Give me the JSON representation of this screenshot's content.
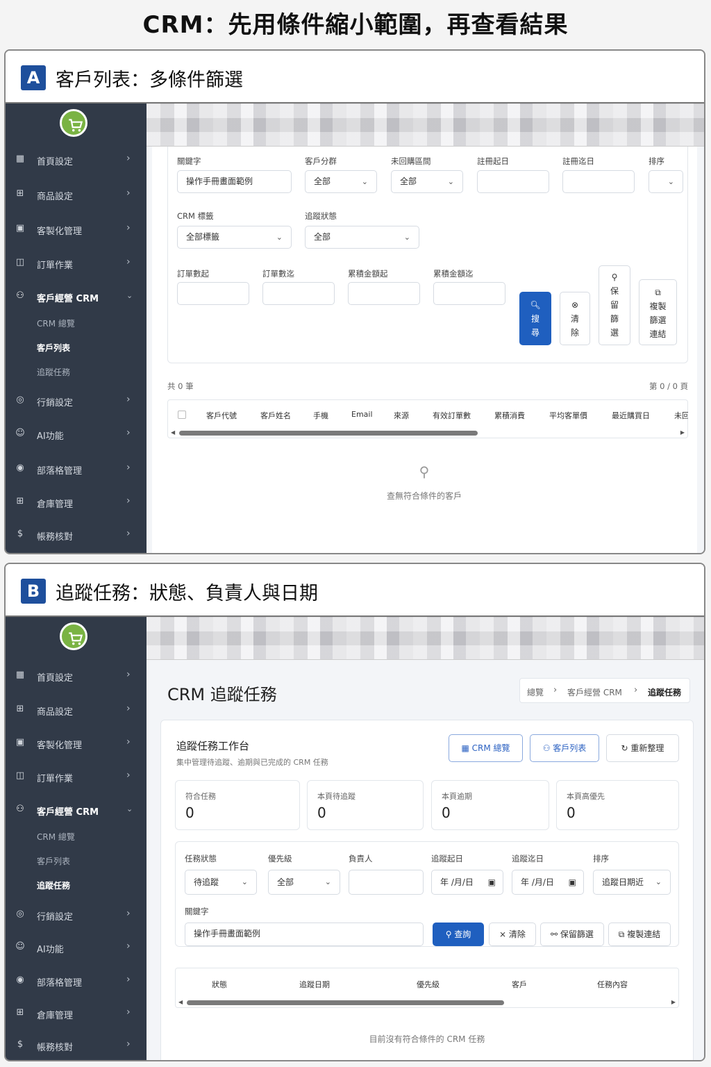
{
  "main_title": "CRM：先用條件縮小範圍，再查看結果",
  "panel_a": {
    "badge": "A",
    "title": "客戶列表：多條件篩選",
    "sidebar": {
      "items": [
        {
          "icon": "store-icon",
          "label": "首頁設定"
        },
        {
          "icon": "gift-icon",
          "label": "商品設定"
        },
        {
          "icon": "layout-icon",
          "label": "客製化管理"
        },
        {
          "icon": "clipboard-icon",
          "label": "訂單作業"
        },
        {
          "icon": "users-icon",
          "label": "客戶經營 CRM"
        },
        {
          "icon": "target-icon",
          "label": "行銷設定"
        },
        {
          "icon": "robot-icon",
          "label": "AI功能"
        },
        {
          "icon": "blog-icon",
          "label": "部落格管理"
        },
        {
          "icon": "warehouse-icon",
          "label": "倉庫管理"
        },
        {
          "icon": "dollar-icon",
          "label": "帳務核對"
        }
      ],
      "sub_items": [
        "CRM 總覽",
        "客戶列表",
        "追蹤任務"
      ]
    },
    "filters": {
      "keyword_label": "關鍵字",
      "keyword_value": "操作手冊畫面範例",
      "segment_label": "客戶分群",
      "segment_value": "全部",
      "no_purchase_label": "未回購區間",
      "no_purchase_value": "全部",
      "reg_start_label": "註冊起日",
      "reg_end_label": "註冊迄日",
      "sort_label": "排序",
      "crm_tag_label": "CRM 標籤",
      "crm_tag_value": "全部標籤",
      "track_status_label": "追蹤狀態",
      "track_status_value": "全部",
      "orders_min_label": "訂單數起",
      "orders_max_label": "訂單數迄",
      "amount_min_label": "累積金額起",
      "amount_max_label": "累積金額迄"
    },
    "buttons": {
      "search": [
        "搜",
        "尋"
      ],
      "clear": [
        "清",
        "除"
      ],
      "save_filter": [
        "保",
        "留",
        "篩",
        "選"
      ],
      "copy_link": [
        "複製",
        "篩選",
        "連結"
      ]
    },
    "summary": {
      "count": "共 0 筆",
      "page": "第 0 / 0 頁"
    },
    "table_headers": [
      "客戶代號",
      "客戶姓名",
      "手機",
      "Email",
      "來源",
      "有效訂單數",
      "累積消費",
      "平均客單價",
      "最近購買日",
      "未回"
    ],
    "empty_text": "查無符合條件的客戶"
  },
  "panel_b": {
    "badge": "B",
    "title": "追蹤任務：狀態、負責人與日期",
    "page_title": "CRM 追蹤任務",
    "breadcrumb": [
      "總覽",
      "客戶經營 CRM",
      "追蹤任務"
    ],
    "workbench_title": "追蹤任務工作台",
    "workbench_sub": "集中管理待追蹤、逾期與已完成的 CRM 任務",
    "header_buttons": {
      "crm_overview": "CRM 總覽",
      "customer_list": "客戶列表",
      "refresh": "重新整理"
    },
    "stats": [
      {
        "label": "符合任務",
        "value": "0"
      },
      {
        "label": "本頁待追蹤",
        "value": "0"
      },
      {
        "label": "本頁逾期",
        "value": "0"
      },
      {
        "label": "本頁高優先",
        "value": "0"
      }
    ],
    "filters": {
      "status_label": "任務狀態",
      "status_value": "待追蹤",
      "priority_label": "優先級",
      "priority_value": "全部",
      "owner_label": "負責人",
      "date_start_label": "追蹤起日",
      "date_start_value": "年 /月/日",
      "date_end_label": "追蹤迄日",
      "date_end_value": "年 /月/日",
      "sort_label": "排序",
      "sort_value": "追蹤日期近",
      "keyword_label": "關鍵字",
      "keyword_value": "操作手冊畫面範例"
    },
    "action_buttons": {
      "query": "查詢",
      "clear": "清除",
      "save_filter": "保留篩選",
      "copy_link": "複製連結"
    },
    "table_headers": [
      "狀態",
      "追蹤日期",
      "優先級",
      "客戶",
      "任務內容"
    ],
    "empty_text": "目前沒有符合條件的 CRM 任務",
    "scroll_fraction": 0.66
  },
  "colors": {
    "primary": "#1f5fbf",
    "sidebar": "#313a48",
    "logo": "#7ab343"
  }
}
